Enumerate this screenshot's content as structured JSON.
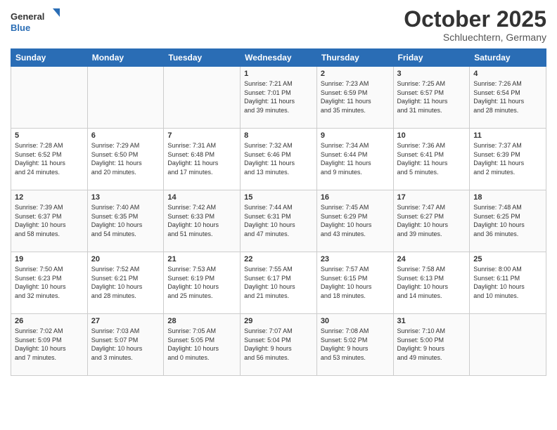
{
  "header": {
    "logo_general": "General",
    "logo_blue": "Blue",
    "month_title": "October 2025",
    "location": "Schluechtern, Germany"
  },
  "weekdays": [
    "Sunday",
    "Monday",
    "Tuesday",
    "Wednesday",
    "Thursday",
    "Friday",
    "Saturday"
  ],
  "weeks": [
    [
      {
        "day": "",
        "info": ""
      },
      {
        "day": "",
        "info": ""
      },
      {
        "day": "",
        "info": ""
      },
      {
        "day": "1",
        "info": "Sunrise: 7:21 AM\nSunset: 7:01 PM\nDaylight: 11 hours\nand 39 minutes."
      },
      {
        "day": "2",
        "info": "Sunrise: 7:23 AM\nSunset: 6:59 PM\nDaylight: 11 hours\nand 35 minutes."
      },
      {
        "day": "3",
        "info": "Sunrise: 7:25 AM\nSunset: 6:57 PM\nDaylight: 11 hours\nand 31 minutes."
      },
      {
        "day": "4",
        "info": "Sunrise: 7:26 AM\nSunset: 6:54 PM\nDaylight: 11 hours\nand 28 minutes."
      }
    ],
    [
      {
        "day": "5",
        "info": "Sunrise: 7:28 AM\nSunset: 6:52 PM\nDaylight: 11 hours\nand 24 minutes."
      },
      {
        "day": "6",
        "info": "Sunrise: 7:29 AM\nSunset: 6:50 PM\nDaylight: 11 hours\nand 20 minutes."
      },
      {
        "day": "7",
        "info": "Sunrise: 7:31 AM\nSunset: 6:48 PM\nDaylight: 11 hours\nand 17 minutes."
      },
      {
        "day": "8",
        "info": "Sunrise: 7:32 AM\nSunset: 6:46 PM\nDaylight: 11 hours\nand 13 minutes."
      },
      {
        "day": "9",
        "info": "Sunrise: 7:34 AM\nSunset: 6:44 PM\nDaylight: 11 hours\nand 9 minutes."
      },
      {
        "day": "10",
        "info": "Sunrise: 7:36 AM\nSunset: 6:41 PM\nDaylight: 11 hours\nand 5 minutes."
      },
      {
        "day": "11",
        "info": "Sunrise: 7:37 AM\nSunset: 6:39 PM\nDaylight: 11 hours\nand 2 minutes."
      }
    ],
    [
      {
        "day": "12",
        "info": "Sunrise: 7:39 AM\nSunset: 6:37 PM\nDaylight: 10 hours\nand 58 minutes."
      },
      {
        "day": "13",
        "info": "Sunrise: 7:40 AM\nSunset: 6:35 PM\nDaylight: 10 hours\nand 54 minutes."
      },
      {
        "day": "14",
        "info": "Sunrise: 7:42 AM\nSunset: 6:33 PM\nDaylight: 10 hours\nand 51 minutes."
      },
      {
        "day": "15",
        "info": "Sunrise: 7:44 AM\nSunset: 6:31 PM\nDaylight: 10 hours\nand 47 minutes."
      },
      {
        "day": "16",
        "info": "Sunrise: 7:45 AM\nSunset: 6:29 PM\nDaylight: 10 hours\nand 43 minutes."
      },
      {
        "day": "17",
        "info": "Sunrise: 7:47 AM\nSunset: 6:27 PM\nDaylight: 10 hours\nand 39 minutes."
      },
      {
        "day": "18",
        "info": "Sunrise: 7:48 AM\nSunset: 6:25 PM\nDaylight: 10 hours\nand 36 minutes."
      }
    ],
    [
      {
        "day": "19",
        "info": "Sunrise: 7:50 AM\nSunset: 6:23 PM\nDaylight: 10 hours\nand 32 minutes."
      },
      {
        "day": "20",
        "info": "Sunrise: 7:52 AM\nSunset: 6:21 PM\nDaylight: 10 hours\nand 28 minutes."
      },
      {
        "day": "21",
        "info": "Sunrise: 7:53 AM\nSunset: 6:19 PM\nDaylight: 10 hours\nand 25 minutes."
      },
      {
        "day": "22",
        "info": "Sunrise: 7:55 AM\nSunset: 6:17 PM\nDaylight: 10 hours\nand 21 minutes."
      },
      {
        "day": "23",
        "info": "Sunrise: 7:57 AM\nSunset: 6:15 PM\nDaylight: 10 hours\nand 18 minutes."
      },
      {
        "day": "24",
        "info": "Sunrise: 7:58 AM\nSunset: 6:13 PM\nDaylight: 10 hours\nand 14 minutes."
      },
      {
        "day": "25",
        "info": "Sunrise: 8:00 AM\nSunset: 6:11 PM\nDaylight: 10 hours\nand 10 minutes."
      }
    ],
    [
      {
        "day": "26",
        "info": "Sunrise: 7:02 AM\nSunset: 5:09 PM\nDaylight: 10 hours\nand 7 minutes."
      },
      {
        "day": "27",
        "info": "Sunrise: 7:03 AM\nSunset: 5:07 PM\nDaylight: 10 hours\nand 3 minutes."
      },
      {
        "day": "28",
        "info": "Sunrise: 7:05 AM\nSunset: 5:05 PM\nDaylight: 10 hours\nand 0 minutes."
      },
      {
        "day": "29",
        "info": "Sunrise: 7:07 AM\nSunset: 5:04 PM\nDaylight: 9 hours\nand 56 minutes."
      },
      {
        "day": "30",
        "info": "Sunrise: 7:08 AM\nSunset: 5:02 PM\nDaylight: 9 hours\nand 53 minutes."
      },
      {
        "day": "31",
        "info": "Sunrise: 7:10 AM\nSunset: 5:00 PM\nDaylight: 9 hours\nand 49 minutes."
      },
      {
        "day": "",
        "info": ""
      }
    ]
  ]
}
